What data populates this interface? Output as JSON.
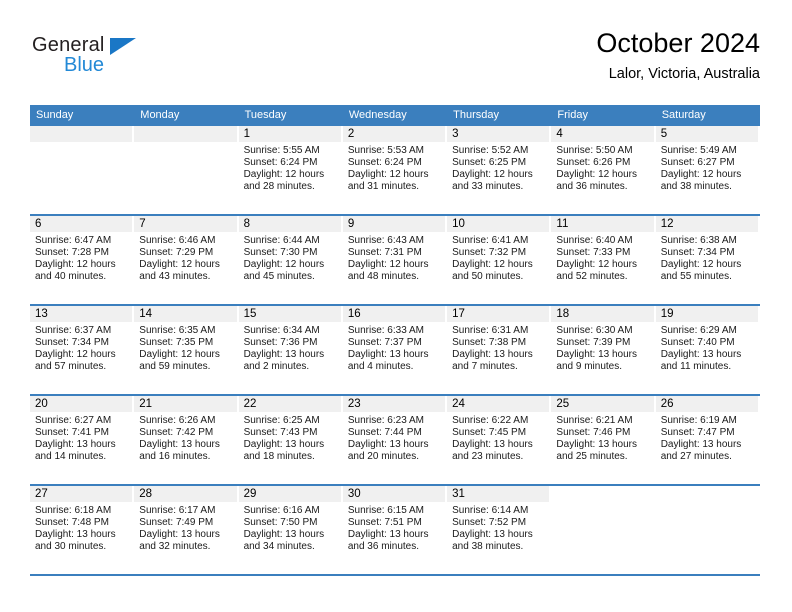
{
  "brand": {
    "name_top": "General",
    "name_bottom": "Blue",
    "triangle_color": "#1a77c6",
    "blue_color": "#2389d6"
  },
  "header": {
    "title": "October 2024",
    "subtitle": "Lalor, Victoria, Australia"
  },
  "theme": {
    "header_blue": "#3b7fbe",
    "daynum_band": "#f0f0f0",
    "text": "#000000"
  },
  "weekdays": [
    "Sunday",
    "Monday",
    "Tuesday",
    "Wednesday",
    "Thursday",
    "Friday",
    "Saturday"
  ],
  "weeks": [
    [
      {
        "day": "",
        "sunrise": "",
        "sunset": "",
        "daylight": ""
      },
      {
        "day": "",
        "sunrise": "",
        "sunset": "",
        "daylight": ""
      },
      {
        "day": "1",
        "sunrise": "Sunrise: 5:55 AM",
        "sunset": "Sunset: 6:24 PM",
        "daylight": "Daylight: 12 hours and 28 minutes."
      },
      {
        "day": "2",
        "sunrise": "Sunrise: 5:53 AM",
        "sunset": "Sunset: 6:24 PM",
        "daylight": "Daylight: 12 hours and 31 minutes."
      },
      {
        "day": "3",
        "sunrise": "Sunrise: 5:52 AM",
        "sunset": "Sunset: 6:25 PM",
        "daylight": "Daylight: 12 hours and 33 minutes."
      },
      {
        "day": "4",
        "sunrise": "Sunrise: 5:50 AM",
        "sunset": "Sunset: 6:26 PM",
        "daylight": "Daylight: 12 hours and 36 minutes."
      },
      {
        "day": "5",
        "sunrise": "Sunrise: 5:49 AM",
        "sunset": "Sunset: 6:27 PM",
        "daylight": "Daylight: 12 hours and 38 minutes."
      }
    ],
    [
      {
        "day": "6",
        "sunrise": "Sunrise: 6:47 AM",
        "sunset": "Sunset: 7:28 PM",
        "daylight": "Daylight: 12 hours and 40 minutes."
      },
      {
        "day": "7",
        "sunrise": "Sunrise: 6:46 AM",
        "sunset": "Sunset: 7:29 PM",
        "daylight": "Daylight: 12 hours and 43 minutes."
      },
      {
        "day": "8",
        "sunrise": "Sunrise: 6:44 AM",
        "sunset": "Sunset: 7:30 PM",
        "daylight": "Daylight: 12 hours and 45 minutes."
      },
      {
        "day": "9",
        "sunrise": "Sunrise: 6:43 AM",
        "sunset": "Sunset: 7:31 PM",
        "daylight": "Daylight: 12 hours and 48 minutes."
      },
      {
        "day": "10",
        "sunrise": "Sunrise: 6:41 AM",
        "sunset": "Sunset: 7:32 PM",
        "daylight": "Daylight: 12 hours and 50 minutes."
      },
      {
        "day": "11",
        "sunrise": "Sunrise: 6:40 AM",
        "sunset": "Sunset: 7:33 PM",
        "daylight": "Daylight: 12 hours and 52 minutes."
      },
      {
        "day": "12",
        "sunrise": "Sunrise: 6:38 AM",
        "sunset": "Sunset: 7:34 PM",
        "daylight": "Daylight: 12 hours and 55 minutes."
      }
    ],
    [
      {
        "day": "13",
        "sunrise": "Sunrise: 6:37 AM",
        "sunset": "Sunset: 7:34 PM",
        "daylight": "Daylight: 12 hours and 57 minutes."
      },
      {
        "day": "14",
        "sunrise": "Sunrise: 6:35 AM",
        "sunset": "Sunset: 7:35 PM",
        "daylight": "Daylight: 12 hours and 59 minutes."
      },
      {
        "day": "15",
        "sunrise": "Sunrise: 6:34 AM",
        "sunset": "Sunset: 7:36 PM",
        "daylight": "Daylight: 13 hours and 2 minutes."
      },
      {
        "day": "16",
        "sunrise": "Sunrise: 6:33 AM",
        "sunset": "Sunset: 7:37 PM",
        "daylight": "Daylight: 13 hours and 4 minutes."
      },
      {
        "day": "17",
        "sunrise": "Sunrise: 6:31 AM",
        "sunset": "Sunset: 7:38 PM",
        "daylight": "Daylight: 13 hours and 7 minutes."
      },
      {
        "day": "18",
        "sunrise": "Sunrise: 6:30 AM",
        "sunset": "Sunset: 7:39 PM",
        "daylight": "Daylight: 13 hours and 9 minutes."
      },
      {
        "day": "19",
        "sunrise": "Sunrise: 6:29 AM",
        "sunset": "Sunset: 7:40 PM",
        "daylight": "Daylight: 13 hours and 11 minutes."
      }
    ],
    [
      {
        "day": "20",
        "sunrise": "Sunrise: 6:27 AM",
        "sunset": "Sunset: 7:41 PM",
        "daylight": "Daylight: 13 hours and 14 minutes."
      },
      {
        "day": "21",
        "sunrise": "Sunrise: 6:26 AM",
        "sunset": "Sunset: 7:42 PM",
        "daylight": "Daylight: 13 hours and 16 minutes."
      },
      {
        "day": "22",
        "sunrise": "Sunrise: 6:25 AM",
        "sunset": "Sunset: 7:43 PM",
        "daylight": "Daylight: 13 hours and 18 minutes."
      },
      {
        "day": "23",
        "sunrise": "Sunrise: 6:23 AM",
        "sunset": "Sunset: 7:44 PM",
        "daylight": "Daylight: 13 hours and 20 minutes."
      },
      {
        "day": "24",
        "sunrise": "Sunrise: 6:22 AM",
        "sunset": "Sunset: 7:45 PM",
        "daylight": "Daylight: 13 hours and 23 minutes."
      },
      {
        "day": "25",
        "sunrise": "Sunrise: 6:21 AM",
        "sunset": "Sunset: 7:46 PM",
        "daylight": "Daylight: 13 hours and 25 minutes."
      },
      {
        "day": "26",
        "sunrise": "Sunrise: 6:19 AM",
        "sunset": "Sunset: 7:47 PM",
        "daylight": "Daylight: 13 hours and 27 minutes."
      }
    ],
    [
      {
        "day": "27",
        "sunrise": "Sunrise: 6:18 AM",
        "sunset": "Sunset: 7:48 PM",
        "daylight": "Daylight: 13 hours and 30 minutes."
      },
      {
        "day": "28",
        "sunrise": "Sunrise: 6:17 AM",
        "sunset": "Sunset: 7:49 PM",
        "daylight": "Daylight: 13 hours and 32 minutes."
      },
      {
        "day": "29",
        "sunrise": "Sunrise: 6:16 AM",
        "sunset": "Sunset: 7:50 PM",
        "daylight": "Daylight: 13 hours and 34 minutes."
      },
      {
        "day": "30",
        "sunrise": "Sunrise: 6:15 AM",
        "sunset": "Sunset: 7:51 PM",
        "daylight": "Daylight: 13 hours and 36 minutes."
      },
      {
        "day": "31",
        "sunrise": "Sunrise: 6:14 AM",
        "sunset": "Sunset: 7:52 PM",
        "daylight": "Daylight: 13 hours and 38 minutes."
      },
      {
        "day": "",
        "sunrise": "",
        "sunset": "",
        "daylight": ""
      },
      {
        "day": "",
        "sunrise": "",
        "sunset": "",
        "daylight": ""
      }
    ]
  ]
}
